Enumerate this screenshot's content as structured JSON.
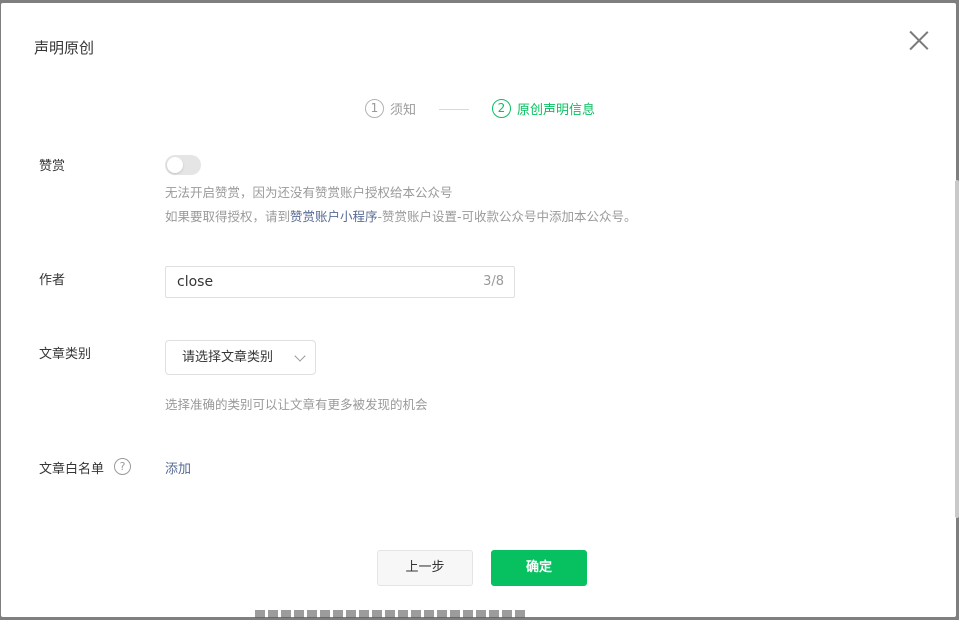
{
  "dialog": {
    "title": "声明原创",
    "close_icon": "close-icon"
  },
  "steps": [
    {
      "num": "1",
      "label": "须知"
    },
    {
      "num": "2",
      "label": "原创声明信息"
    }
  ],
  "reward": {
    "label": "赞赏",
    "enabled": false,
    "tip_line1": "无法开启赞赏，因为还没有赞赏账户授权给本公众号",
    "tip_line2_prefix": "如果要取得授权，请到",
    "tip_line2_link": "赞赏账户小程序",
    "tip_line2_suffix": "-赞赏账户设置-可收款公众号中添加本公众号。"
  },
  "author": {
    "label": "作者",
    "value": "close",
    "count": "3/8"
  },
  "category": {
    "label": "文章类别",
    "placeholder": "请选择文章类别",
    "tip": "选择准确的类别可以让文章有更多被发现的机会"
  },
  "whitelist": {
    "label": "文章白名单",
    "help_icon": "?",
    "add_link": "添加"
  },
  "footer": {
    "prev_label": "上一步",
    "confirm_label": "确定"
  },
  "colors": {
    "accent": "#07c160",
    "link": "#576b95"
  }
}
